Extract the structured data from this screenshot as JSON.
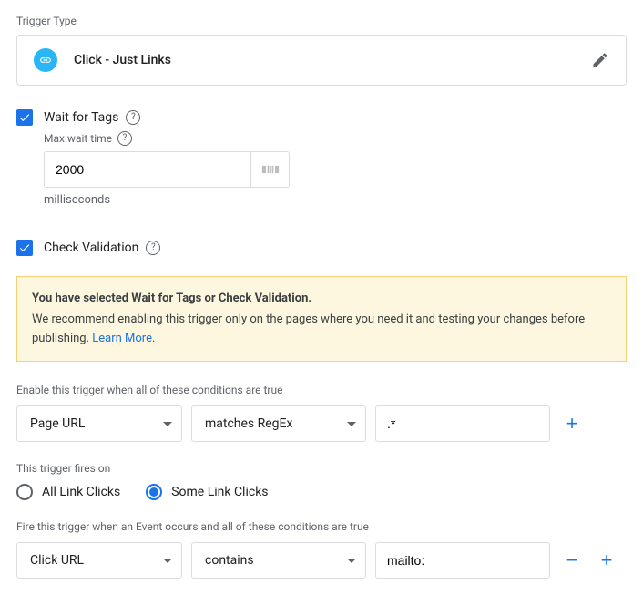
{
  "labels": {
    "trigger_type": "Trigger Type",
    "trigger_name": "Click - Just Links",
    "wait_for_tags": "Wait for Tags",
    "max_wait_time": "Max wait time",
    "milliseconds": "milliseconds",
    "check_validation": "Check Validation",
    "warning_bold": "You have selected Wait for Tags or Check Validation.",
    "warning_body": "We recommend enabling this trigger only on the pages where you need it and testing your changes before publishing. ",
    "learn_more": "Learn More",
    "enable_conditions_label": "Enable this trigger when all of these conditions are true",
    "fires_on_label": "This trigger fires on",
    "radio_all": "All Link Clicks",
    "radio_some": "Some Link Clicks",
    "fire_conditions_label": "Fire this trigger when an Event occurs and all of these conditions are true"
  },
  "values": {
    "max_wait_time": "2000",
    "enable_variable": "Page URL",
    "enable_operator": "matches RegEx",
    "enable_value": ".*",
    "fire_variable": "Click URL",
    "fire_operator": "contains",
    "fire_value": "mailto:"
  },
  "state": {
    "wait_for_tags_checked": true,
    "check_validation_checked": true,
    "fires_on": "some"
  }
}
